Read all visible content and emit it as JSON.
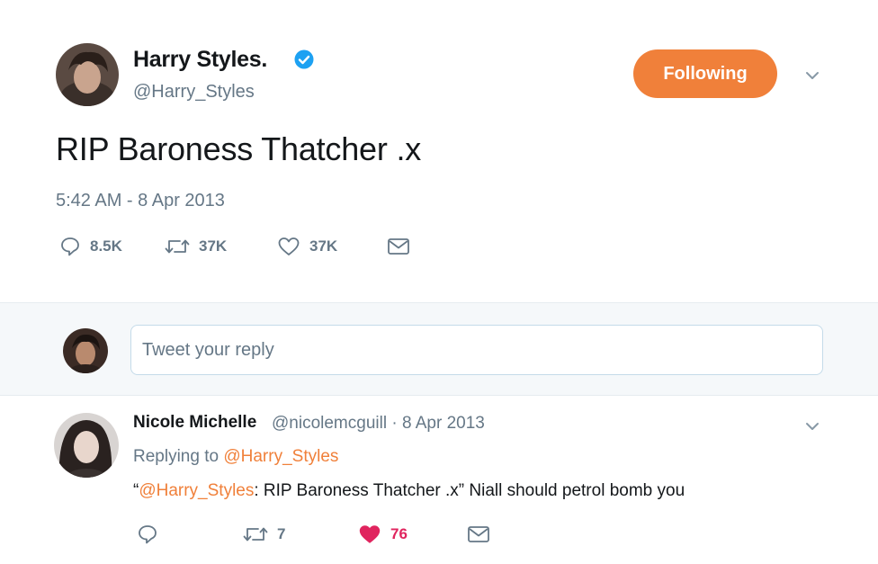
{
  "tweet": {
    "author_name": "Harry Styles.",
    "author_handle": "@Harry_Styles",
    "follow_label": "Following",
    "text": "RIP Baroness Thatcher .x",
    "timestamp": "5:42 AM - 8 Apr 2013",
    "actions": {
      "replies": "8.5K",
      "retweets": "37K",
      "likes": "37K"
    }
  },
  "reply_box": {
    "placeholder": "Tweet your reply"
  },
  "reply": {
    "author_name": "Nicole Michelle",
    "author_handle": "@nicolemcguill",
    "separator": " · ",
    "date": "8 Apr 2013",
    "replying_prefix": "Replying to ",
    "replying_handle": "@Harry_Styles",
    "quote_open": "“",
    "quote_handle": "@Harry_Styles",
    "quote_rest": ": RIP Baroness Thatcher .x” Niall should petrol bomb you",
    "actions": {
      "retweets": "7",
      "likes": "76"
    }
  },
  "colors": {
    "accent": "#f0803a",
    "verified": "#1da1f2",
    "like_active": "#e0245e",
    "muted": "#657786"
  }
}
